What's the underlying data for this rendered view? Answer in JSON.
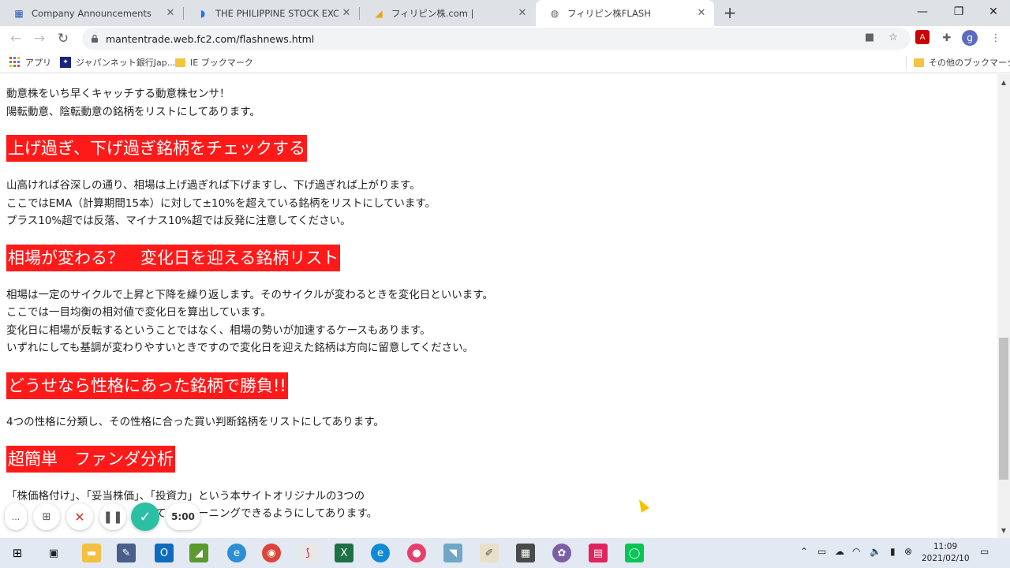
{
  "browser": {
    "tabs": [
      {
        "title": "Company Announcements",
        "icon": "company-icon"
      },
      {
        "title": "THE PHILIPPINE STOCK EXCHANG",
        "icon": "pse-icon"
      },
      {
        "title": "フィリピン株.com |",
        "icon": "chart-icon"
      },
      {
        "title": "フィリピン株FLASH",
        "icon": "globe-icon"
      }
    ],
    "url": "mantentrade.web.fc2.com/flashnews.html",
    "profile_initial": "g",
    "bookmarks": {
      "apps": "アプリ",
      "bank": "ジャパンネット銀行Jap...",
      "ie": "IE ブックマーク",
      "other": "その他のブックマーク"
    }
  },
  "content": {
    "intro": [
      "動意株をいち早くキャッチする動意株センサ！",
      "陽転動意、陰転動意の銘柄をリストにしてあります。"
    ],
    "sections": [
      {
        "heading": "上げ過ぎ、下げ過ぎ銘柄をチェックする",
        "lines": [
          "山高ければ谷深しの通り、相場は上げ過ぎれば下げますし、下げ過ぎれば上がります。",
          "ここではEMA（計算期間15本）に対して±10%を超えている銘柄をリストにしています。",
          "プラス10%超では反落、マイナス10%超では反発に注意してください。"
        ]
      },
      {
        "heading": "相場が変わる？　変化日を迎える銘柄リスト",
        "lines": [
          "相場は一定のサイクルで上昇と下降を繰り返します。そのサイクルが変わるときを変化日といいます。",
          "ここでは一目均衡の相対値で変化日を算出しています。",
          "変化日に相場が反転するということではなく、相場の勢いが加速するケースもあります。",
          "いずれにしても基調が変わりやすいときですので変化日を迎えた銘柄は方向に留意してください。"
        ]
      },
      {
        "heading": "どうせなら性格にあった銘柄で勝負!!",
        "lines": [
          "4つの性格に分類し、その性格に合った買い判断銘柄をリストにしてあります。"
        ]
      },
      {
        "heading": "超簡単　ファンダ分析",
        "lines": [
          "「株価格付け」、「妥当株価」、「投資力」という本サイトオリジナルの3つの",
          "　　　　　　　　　　　　とめてスクリーニングできるようにしてあります。"
        ]
      }
    ]
  },
  "recorder": {
    "more": "...",
    "timer": "5:00"
  },
  "taskbar": {
    "time": "11:09",
    "date": "2021/02/10"
  },
  "colors": {
    "heading_bg": "#ff1a1a",
    "tab_strip": "#dee1e6",
    "recorder_ok": "#2bbfa4"
  }
}
